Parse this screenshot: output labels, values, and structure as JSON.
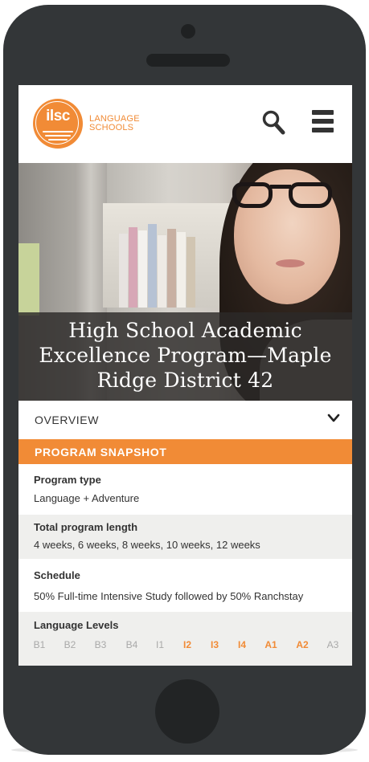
{
  "brand": {
    "logo_mark": "ilsc",
    "logo_line1": "LANGUAGE",
    "logo_line2": "SCHOOLS",
    "accent_color": "#f18b36"
  },
  "header": {
    "search_icon": "search-icon",
    "menu_icon": "hamburger-menu-icon"
  },
  "hero": {
    "title": "High School Academic Excellence Program—Maple Ridge District 42"
  },
  "overview": {
    "label": "OVERVIEW",
    "icon": "chevron-down-icon"
  },
  "snapshot": {
    "title": "PROGRAM SNAPSHOT",
    "rows": [
      {
        "label": "Program type",
        "value": "Language + Adventure"
      },
      {
        "label": "Total program length",
        "value": "4 weeks, 6 weeks, 8 weeks, 10 weeks, 12 weeks"
      },
      {
        "label": "Schedule",
        "value": "50% Full-time Intensive Study followed by 50% Ranchstay"
      }
    ],
    "levels_label": "Language Levels",
    "levels": [
      {
        "code": "B1",
        "active": false
      },
      {
        "code": "B2",
        "active": false
      },
      {
        "code": "B3",
        "active": false
      },
      {
        "code": "B4",
        "active": false
      },
      {
        "code": "I1",
        "active": false
      },
      {
        "code": "I2",
        "active": true
      },
      {
        "code": "I3",
        "active": true
      },
      {
        "code": "I4",
        "active": true
      },
      {
        "code": "A1",
        "active": true
      },
      {
        "code": "A2",
        "active": true
      },
      {
        "code": "A3",
        "active": false
      }
    ]
  }
}
